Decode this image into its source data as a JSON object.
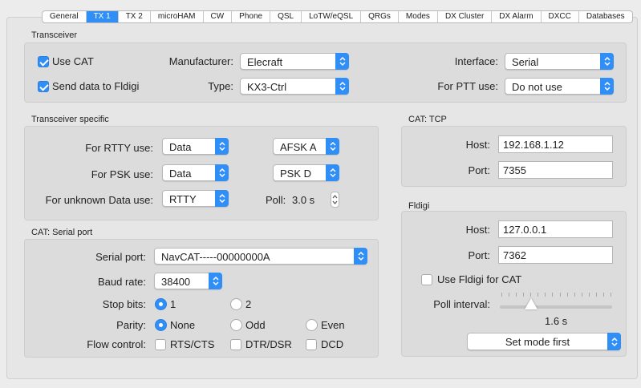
{
  "tabs": [
    "General",
    "TX 1",
    "TX 2",
    "microHAM",
    "CW",
    "Phone",
    "QSL",
    "LoTW/eQSL",
    "QRGs",
    "Modes",
    "DX Cluster",
    "DX Alarm",
    "DXCC",
    "Databases"
  ],
  "active_tab": "TX 1",
  "colors": {
    "accent": "#2f8ff7",
    "pane": "#e6e6e6",
    "box": "#dcdcdc"
  },
  "transceiver": {
    "title": "Transceiver",
    "use_cat_label": "Use CAT",
    "use_cat_checked": true,
    "send_fldigi_label": "Send data to Fldigi",
    "send_fldigi_checked": true,
    "manufacturer_label": "Manufacturer:",
    "manufacturer_value": "Elecraft",
    "type_label": "Type:",
    "type_value": "KX3-Ctrl",
    "interface_label": "Interface:",
    "interface_value": "Serial",
    "ptt_label": "For PTT use:",
    "ptt_value": "Do not use"
  },
  "specific": {
    "title": "Transceiver specific",
    "rtty_label": "For RTTY use:",
    "rtty_value": "Data",
    "rtty_mode": "AFSK A",
    "psk_label": "For PSK use:",
    "psk_value": "Data",
    "psk_mode": "PSK D",
    "unknown_label": "For unknown Data use:",
    "unknown_value": "RTTY",
    "poll_label": "Poll:",
    "poll_value": "3.0 s"
  },
  "serial": {
    "title": "CAT: Serial port",
    "port_label": "Serial port:",
    "port_value": "NavCAT-----00000000A",
    "baud_label": "Baud rate:",
    "baud_value": "38400",
    "stop_label": "Stop bits:",
    "stop_options": [
      "1",
      "2"
    ],
    "stop_selected": "1",
    "parity_label": "Parity:",
    "parity_options": [
      "None",
      "Odd",
      "Even"
    ],
    "parity_selected": "None",
    "flow_label": "Flow control:",
    "flow_options": [
      "RTS/CTS",
      "DTR/DSR",
      "DCD"
    ]
  },
  "cat_tcp": {
    "title": "CAT: TCP",
    "host_label": "Host:",
    "host_value": "192.168.1.12",
    "port_label": "Port:",
    "port_value": "7355"
  },
  "fldigi": {
    "title": "Fldigi",
    "host_label": "Host:",
    "host_value": "127.0.0.1",
    "port_label": "Port:",
    "port_value": "7362",
    "use_cat_label": "Use Fldigi for CAT",
    "use_cat_checked": false,
    "poll_label": "Poll interval:",
    "poll_value": "1.6 s",
    "poll_level": 0.28,
    "mode_button": "Set mode first"
  }
}
